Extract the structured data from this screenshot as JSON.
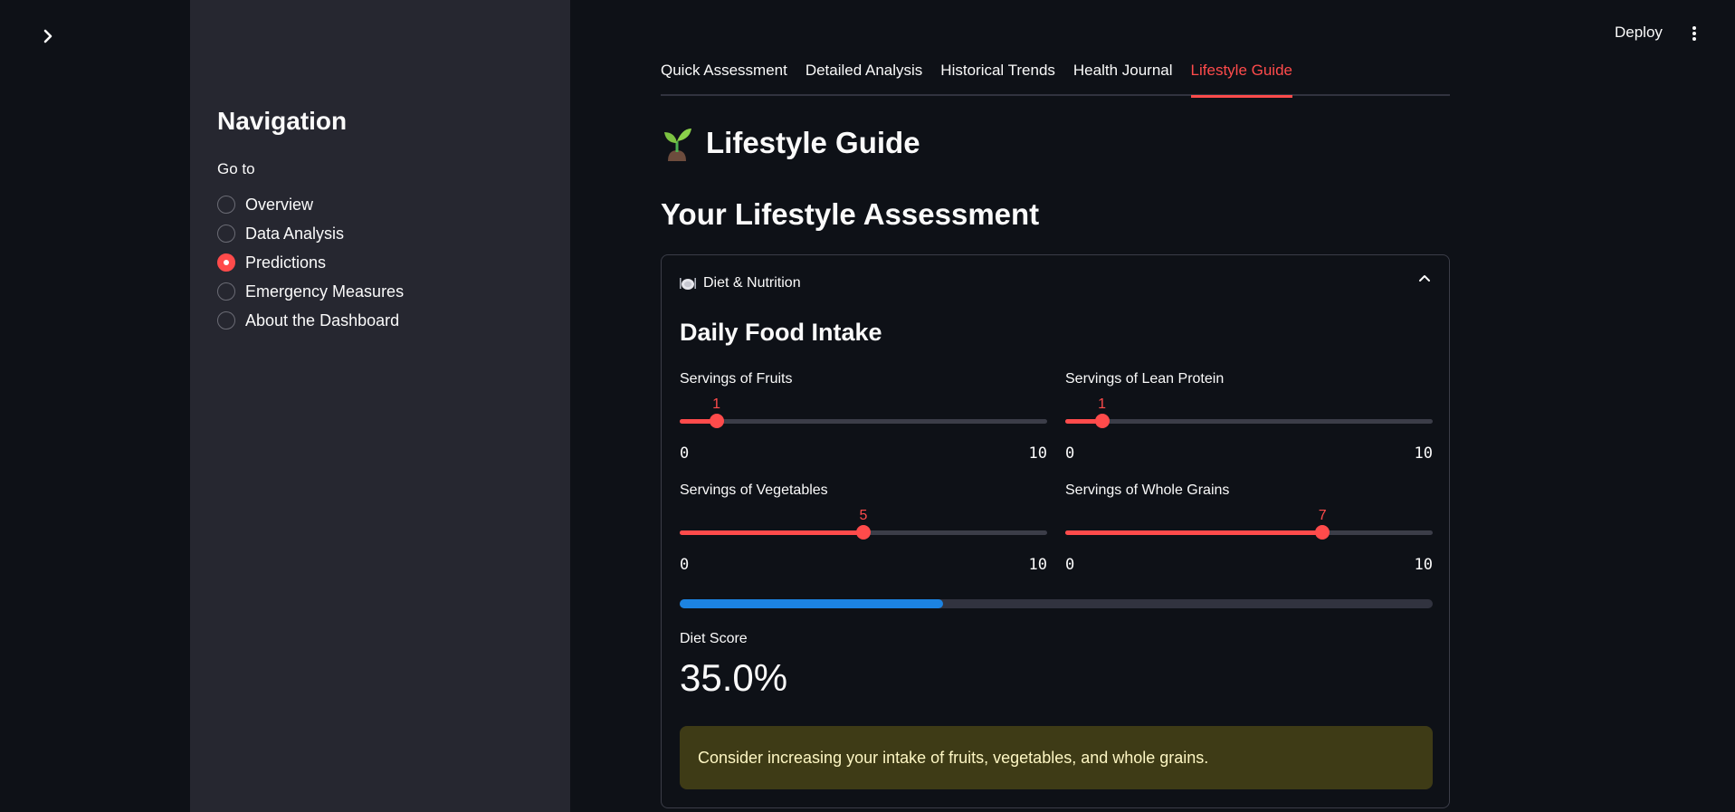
{
  "topbar": {
    "deploy_label": "Deploy",
    "menu_icon": "kebab-menu-icon"
  },
  "sidebar": {
    "title": "Navigation",
    "radio_label": "Go to",
    "items": [
      {
        "label": "Overview",
        "selected": false
      },
      {
        "label": "Data Analysis",
        "selected": false
      },
      {
        "label": "Predictions",
        "selected": true
      },
      {
        "label": "Emergency Measures",
        "selected": false
      },
      {
        "label": "About the Dashboard",
        "selected": false
      }
    ]
  },
  "tabs": [
    {
      "label": "Quick Assessment",
      "active": false
    },
    {
      "label": "Detailed Analysis",
      "active": false
    },
    {
      "label": "Historical Trends",
      "active": false
    },
    {
      "label": "Health Journal",
      "active": false
    },
    {
      "label": "Lifestyle Guide",
      "active": true
    }
  ],
  "page": {
    "title_icon": "seedling-icon",
    "title": "Lifestyle Guide",
    "section_title": "Your Lifestyle Assessment"
  },
  "expander": {
    "icon": "plate-icon",
    "label": "Diet & Nutrition",
    "expanded": true,
    "subheader": "Daily Food Intake",
    "sliders": [
      {
        "label": "Servings of Fruits",
        "value": 1,
        "min": 0,
        "max": 10,
        "min_label": "0",
        "max_label": "10"
      },
      {
        "label": "Servings of Lean Protein",
        "value": 1,
        "min": 0,
        "max": 10,
        "min_label": "0",
        "max_label": "10"
      },
      {
        "label": "Servings of Vegetables",
        "value": 5,
        "min": 0,
        "max": 10,
        "min_label": "0",
        "max_label": "10"
      },
      {
        "label": "Servings of Whole Grains",
        "value": 7,
        "min": 0,
        "max": 10,
        "min_label": "0",
        "max_label": "10"
      }
    ],
    "progress_fraction": 0.35,
    "metric": {
      "label": "Diet Score",
      "value": "35.0%"
    },
    "warning": "Consider increasing your intake of fruits, vegetables, and whole grains."
  },
  "colors": {
    "accent": "#ff4b4b",
    "progress": "#1c83e1",
    "background": "#0e1117",
    "sidebar": "#262730",
    "warning_bg": "#3e3b16"
  }
}
